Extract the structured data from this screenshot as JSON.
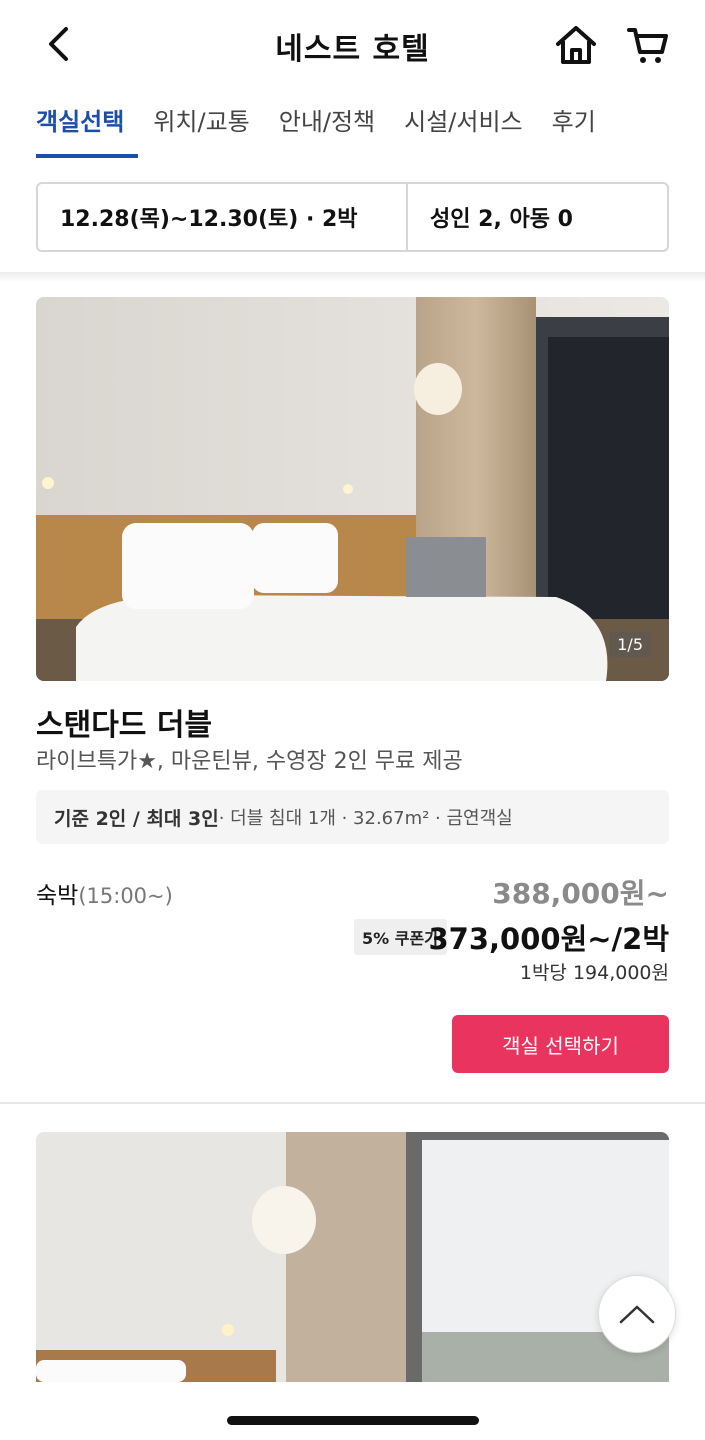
{
  "header": {
    "title": "네스트 호텔",
    "back_icon": "chevron-left-icon",
    "home_icon": "home-icon",
    "cart_icon": "cart-icon"
  },
  "tabs": [
    {
      "label": "객실선택",
      "active": true
    },
    {
      "label": "위치/교통",
      "active": false
    },
    {
      "label": "안내/정책",
      "active": false
    },
    {
      "label": "시설/서비스",
      "active": false
    },
    {
      "label": "후기",
      "active": false
    }
  ],
  "search": {
    "dates": "12.28(목)~12.30(토) · 2박",
    "guests": "성인 2, 아동 0"
  },
  "room": {
    "image_counter": "1/5",
    "name": "스탠다드 더블",
    "description": "라이브특가★, 마운틴뷰, 수영장 2인 무료 제공",
    "capacity": "기준 2인 / 최대 3인",
    "details": " · 더블 침대 1개 · 32.67m² · 금연객실",
    "stay_label": "숙박",
    "stay_time": "(15:00~)",
    "original_price": "388,000원~",
    "coupon_label": "5% 쿠폰가",
    "final_price": "373,000원~/2박",
    "per_night": "1박당 194,000원",
    "select_button": "객실 선택하기"
  },
  "colors": {
    "accent_blue": "#1b4fa8",
    "cta_pink": "#e8345f"
  },
  "scroll_top_icon": "chevron-up-icon"
}
